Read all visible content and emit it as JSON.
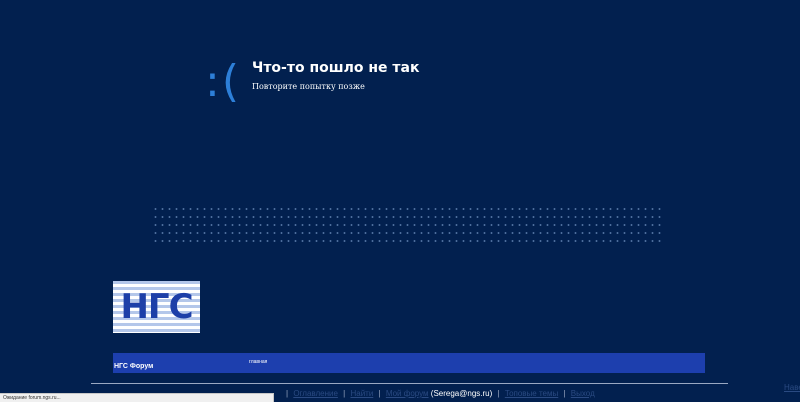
{
  "error": {
    "face": ":(",
    "title": "Что-то пошло не так",
    "subtitle": "Повторите попытку позже"
  },
  "logo": {
    "text": "НГС"
  },
  "nav": {
    "forum_label": "НГС Форум",
    "home_label": "главная"
  },
  "footer_links": {
    "about": "Оглавление",
    "search": "Найти",
    "my_forum": "Мой форум",
    "user_email": "(Serega@ngs.ru)",
    "top_topics": "Топовые темы",
    "logout": "Выход"
  },
  "right_link": "Наве",
  "status_bar": {
    "text": "Ожидание forum.ngs.ru..."
  },
  "colors": {
    "background": "#02204f",
    "accent": "#2d7fd8",
    "nav_bar": "#1d3fae",
    "link": "#2a4a82"
  }
}
